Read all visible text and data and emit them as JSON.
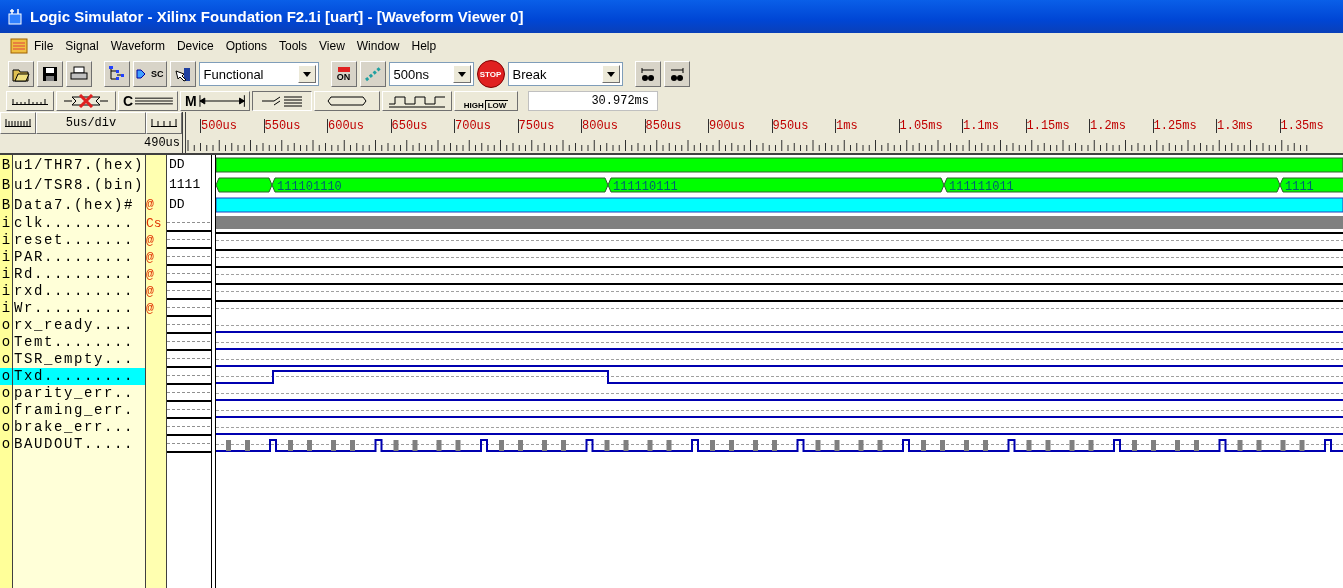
{
  "window": {
    "title": "Logic Simulator - Xilinx Foundation F2.1i [uart] - [Waveform Viewer 0]"
  },
  "menu": [
    "File",
    "Signal",
    "Waveform",
    "Device",
    "Options",
    "Tools",
    "View",
    "Window",
    "Help"
  ],
  "toolbar": {
    "probe_label": "SC",
    "mode": "Functional",
    "on_label": "ON",
    "step": "500ns",
    "stop_label": "STOP",
    "break_mode": "Break"
  },
  "toolbar2": {
    "clear_label": "C",
    "marker_label": "M",
    "high_label": "HIGH",
    "low_label": "LOW",
    "time": "30.972ms"
  },
  "ruler": {
    "scale": "5us/div",
    "start": "490us",
    "labels": [
      "500us",
      "550us",
      "600us",
      "650us",
      "700us",
      "750us",
      "800us",
      "850us",
      "900us",
      "950us",
      "1ms",
      "1.05ms",
      "1.1ms",
      "1.15ms",
      "1.2ms",
      "1.25ms",
      "1.3ms",
      "1.35ms"
    ]
  },
  "signals": [
    {
      "type": "B",
      "name": "u1/THR7.(hex)",
      "value": "DD",
      "kind": "bus",
      "color": "#00ff00",
      "selected": false
    },
    {
      "type": "B",
      "name": "u1/TSR8.(bin)",
      "value": "1111",
      "kind": "bus",
      "color": "#00ff00",
      "segments": [
        "111101110",
        "111110111",
        "111111011",
        "1111"
      ],
      "selected": false
    },
    {
      "type": "B",
      "name": "Data7.(hex)#",
      "marker": "@",
      "value": "DD",
      "kind": "bus",
      "color": "#00ffff",
      "selected": false
    },
    {
      "type": "i",
      "name": "clk.........",
      "marker": "Cs",
      "kind": "clock",
      "selected": false
    },
    {
      "type": "i",
      "name": "reset.......",
      "marker": "@",
      "kind": "unknown",
      "selected": false
    },
    {
      "type": "i",
      "name": "PAR.........",
      "marker": "@",
      "kind": "unknown",
      "selected": false
    },
    {
      "type": "i",
      "name": "Rd..........",
      "marker": "@",
      "kind": "unknown",
      "selected": false
    },
    {
      "type": "i",
      "name": "rxd.........",
      "marker": "@",
      "kind": "unknown",
      "selected": false
    },
    {
      "type": "i",
      "name": "Wr..........",
      "marker": "@",
      "kind": "unknown",
      "selected": false
    },
    {
      "type": "o",
      "name": "rx_ready....",
      "kind": "low",
      "selected": false
    },
    {
      "type": "o",
      "name": "Temt........",
      "kind": "low",
      "selected": false
    },
    {
      "type": "o",
      "name": "TSR_empty...",
      "kind": "low",
      "selected": false
    },
    {
      "type": "o",
      "name": "Txd.........",
      "kind": "serial",
      "selected": true
    },
    {
      "type": "o",
      "name": "parity_err..",
      "kind": "low",
      "selected": false
    },
    {
      "type": "o",
      "name": "framing_err.",
      "kind": "low",
      "selected": false
    },
    {
      "type": "o",
      "name": "brake_err...",
      "kind": "low",
      "selected": false
    },
    {
      "type": "o",
      "name": "BAUDOUT.....",
      "kind": "baud",
      "selected": false
    }
  ]
}
